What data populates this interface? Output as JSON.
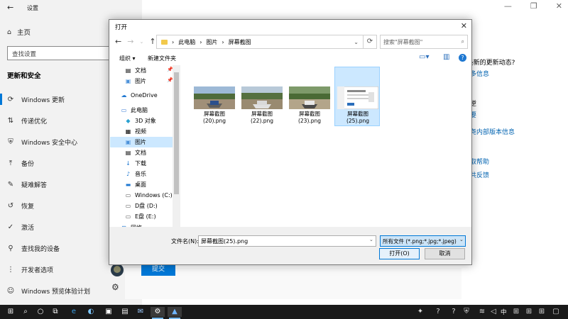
{
  "settings": {
    "title": "设置",
    "home_label": "主页",
    "search_placeholder": "查找设置",
    "section_title": "更新和安全",
    "nav_items": [
      {
        "label": "Windows 更新",
        "icon": "refresh-icon"
      },
      {
        "label": "传递优化",
        "icon": "delivery-icon"
      },
      {
        "label": "Windows 安全中心",
        "icon": "shield-icon"
      },
      {
        "label": "备份",
        "icon": "backup-icon"
      },
      {
        "label": "疑难解答",
        "icon": "wrench-icon"
      },
      {
        "label": "恢复",
        "icon": "recovery-icon"
      },
      {
        "label": "激活",
        "icon": "check-circle-icon"
      },
      {
        "label": "查找我的设备",
        "icon": "person-location-icon"
      },
      {
        "label": "开发者选项",
        "icon": "developer-icon"
      },
      {
        "label": "Windows 预览体验计划",
        "icon": "insider-icon"
      }
    ],
    "right_pane": [
      {
        "text": "E最新的更新动态?",
        "kind": "head"
      },
      {
        "text": "多信息",
        "kind": "link"
      },
      {
        "text": "逆",
        "kind": "head"
      },
      {
        "text": "要",
        "kind": "link"
      },
      {
        "text": "尧内部版本信息",
        "kind": "link"
      },
      {
        "text": "取帮助",
        "kind": "link"
      },
      {
        "text": "共反馈",
        "kind": "link"
      }
    ],
    "submit_label": "提交"
  },
  "dialog": {
    "title": "打开",
    "address": [
      "此电脑",
      "图片",
      "屏幕截图"
    ],
    "search_placeholder": "搜索\"屏幕截图\"",
    "organize_label": "组织 ▾",
    "new_folder_label": "新建文件夹",
    "tree": [
      {
        "label": "文档",
        "icon": "document-icon",
        "pinned": true
      },
      {
        "label": "图片",
        "icon": "picture-icon",
        "pinned": true
      },
      {
        "label": "OneDrive",
        "icon": "cloud-icon"
      },
      {
        "label": "此电脑",
        "icon": "computer-icon"
      },
      {
        "label": "3D 对象",
        "icon": "cube-icon"
      },
      {
        "label": "视频",
        "icon": "video-icon"
      },
      {
        "label": "图片",
        "icon": "picture-icon",
        "selected": true
      },
      {
        "label": "文档",
        "icon": "document-icon"
      },
      {
        "label": "下载",
        "icon": "download-icon"
      },
      {
        "label": "音乐",
        "icon": "music-icon"
      },
      {
        "label": "桌面",
        "icon": "desktop-icon"
      },
      {
        "label": "Windows (C:)",
        "icon": "drive-icon"
      },
      {
        "label": "D盘 (D:)",
        "icon": "drive-icon"
      },
      {
        "label": "E盘 (E:)",
        "icon": "drive-icon"
      },
      {
        "label": "网络",
        "icon": "network-icon"
      }
    ],
    "files": [
      {
        "name": "屏幕截图\n(20).png",
        "kind": "race"
      },
      {
        "name": "屏幕截图\n(22).png",
        "kind": "race"
      },
      {
        "name": "屏幕截图\n(23).png",
        "kind": "race"
      },
      {
        "name": "屏幕截图\n(25).png",
        "kind": "window",
        "selected": true
      }
    ],
    "filename_label": "文件名(N):",
    "filename_value": "屏幕截图(25).png",
    "filetype_value": "所有文件 (*.png;*.jpg;*.jpeg)",
    "open_label": "打开(O)",
    "cancel_label": "取消"
  },
  "taskbar": {
    "apps": [
      "start-icon",
      "search-icon",
      "cortana-icon",
      "task-view-icon",
      "edge-icon",
      "edge-alt-icon",
      "store-icon",
      "mail-icon",
      "settings-icon",
      "photos-icon"
    ],
    "tray_ime": "中"
  },
  "colors": {
    "accent": "#0078d7",
    "selection": "#cce8ff",
    "link": "#0063b1",
    "taskbar": "#1a1a1a"
  }
}
